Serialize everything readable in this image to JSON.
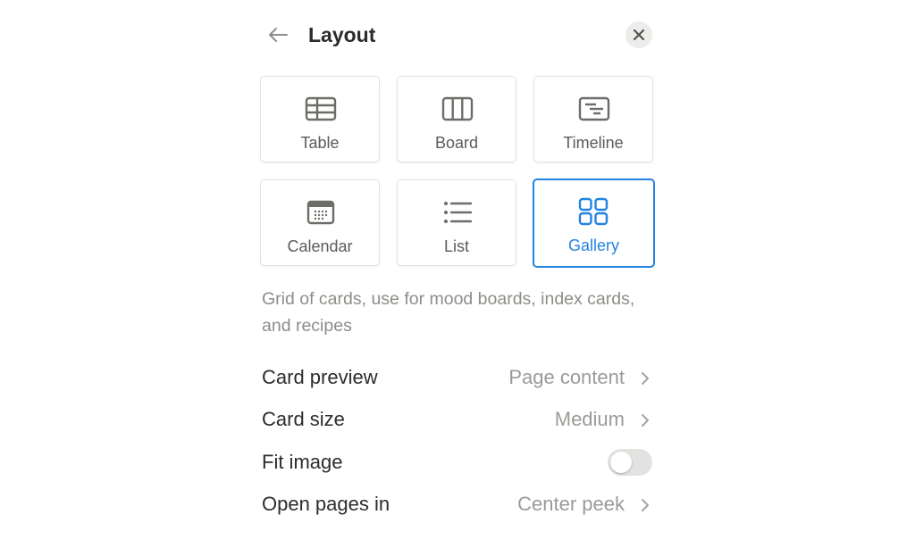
{
  "header": {
    "title": "Layout",
    "back_icon": "arrow-left-icon",
    "close_icon": "close-icon"
  },
  "layouts": [
    {
      "label": "Table",
      "icon": "table-icon",
      "selected": false
    },
    {
      "label": "Board",
      "icon": "board-icon",
      "selected": false
    },
    {
      "label": "Timeline",
      "icon": "timeline-icon",
      "selected": false
    },
    {
      "label": "Calendar",
      "icon": "calendar-icon",
      "selected": false
    },
    {
      "label": "List",
      "icon": "list-icon",
      "selected": false
    },
    {
      "label": "Gallery",
      "icon": "gallery-icon",
      "selected": true
    }
  ],
  "description": "Grid of cards, use for mood boards, index cards, and recipes",
  "settings": {
    "card_preview": {
      "label": "Card preview",
      "value": "Page content"
    },
    "card_size": {
      "label": "Card size",
      "value": "Medium"
    },
    "fit_image": {
      "label": "Fit image",
      "enabled": false
    },
    "open_pages_in": {
      "label": "Open pages in",
      "value": "Center peek"
    }
  },
  "colors": {
    "accent": "#2383e2",
    "icon_gray": "#6e6c68",
    "muted_text": "#9b9a97",
    "toggle_off": "#e3e2e0"
  }
}
